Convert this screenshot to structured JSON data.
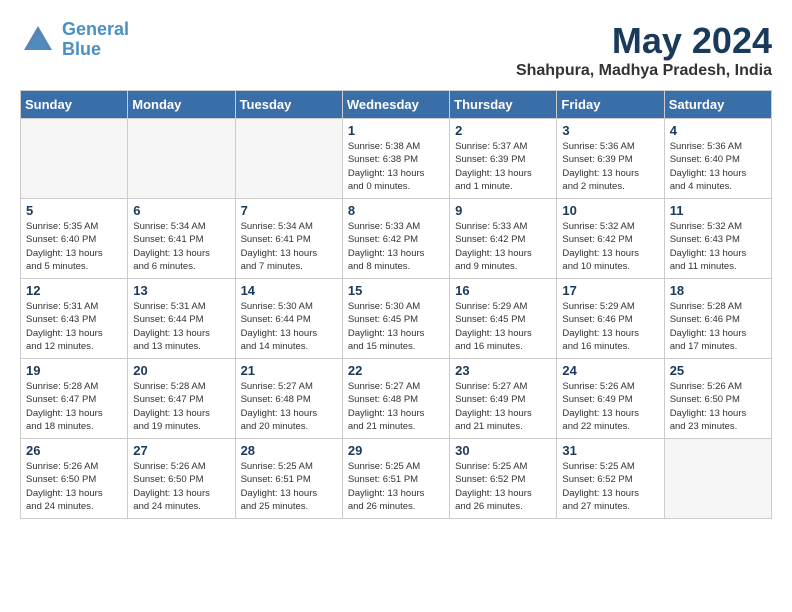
{
  "header": {
    "logo_line1": "General",
    "logo_line2": "Blue",
    "month": "May 2024",
    "location": "Shahpura, Madhya Pradesh, India"
  },
  "weekdays": [
    "Sunday",
    "Monday",
    "Tuesday",
    "Wednesday",
    "Thursday",
    "Friday",
    "Saturday"
  ],
  "weeks": [
    [
      {
        "day": "",
        "info": "",
        "empty": true
      },
      {
        "day": "",
        "info": "",
        "empty": true
      },
      {
        "day": "",
        "info": "",
        "empty": true
      },
      {
        "day": "1",
        "info": "Sunrise: 5:38 AM\nSunset: 6:38 PM\nDaylight: 13 hours\nand 0 minutes."
      },
      {
        "day": "2",
        "info": "Sunrise: 5:37 AM\nSunset: 6:39 PM\nDaylight: 13 hours\nand 1 minute."
      },
      {
        "day": "3",
        "info": "Sunrise: 5:36 AM\nSunset: 6:39 PM\nDaylight: 13 hours\nand 2 minutes."
      },
      {
        "day": "4",
        "info": "Sunrise: 5:36 AM\nSunset: 6:40 PM\nDaylight: 13 hours\nand 4 minutes."
      }
    ],
    [
      {
        "day": "5",
        "info": "Sunrise: 5:35 AM\nSunset: 6:40 PM\nDaylight: 13 hours\nand 5 minutes."
      },
      {
        "day": "6",
        "info": "Sunrise: 5:34 AM\nSunset: 6:41 PM\nDaylight: 13 hours\nand 6 minutes."
      },
      {
        "day": "7",
        "info": "Sunrise: 5:34 AM\nSunset: 6:41 PM\nDaylight: 13 hours\nand 7 minutes."
      },
      {
        "day": "8",
        "info": "Sunrise: 5:33 AM\nSunset: 6:42 PM\nDaylight: 13 hours\nand 8 minutes."
      },
      {
        "day": "9",
        "info": "Sunrise: 5:33 AM\nSunset: 6:42 PM\nDaylight: 13 hours\nand 9 minutes."
      },
      {
        "day": "10",
        "info": "Sunrise: 5:32 AM\nSunset: 6:42 PM\nDaylight: 13 hours\nand 10 minutes."
      },
      {
        "day": "11",
        "info": "Sunrise: 5:32 AM\nSunset: 6:43 PM\nDaylight: 13 hours\nand 11 minutes."
      }
    ],
    [
      {
        "day": "12",
        "info": "Sunrise: 5:31 AM\nSunset: 6:43 PM\nDaylight: 13 hours\nand 12 minutes."
      },
      {
        "day": "13",
        "info": "Sunrise: 5:31 AM\nSunset: 6:44 PM\nDaylight: 13 hours\nand 13 minutes."
      },
      {
        "day": "14",
        "info": "Sunrise: 5:30 AM\nSunset: 6:44 PM\nDaylight: 13 hours\nand 14 minutes."
      },
      {
        "day": "15",
        "info": "Sunrise: 5:30 AM\nSunset: 6:45 PM\nDaylight: 13 hours\nand 15 minutes."
      },
      {
        "day": "16",
        "info": "Sunrise: 5:29 AM\nSunset: 6:45 PM\nDaylight: 13 hours\nand 16 minutes."
      },
      {
        "day": "17",
        "info": "Sunrise: 5:29 AM\nSunset: 6:46 PM\nDaylight: 13 hours\nand 16 minutes."
      },
      {
        "day": "18",
        "info": "Sunrise: 5:28 AM\nSunset: 6:46 PM\nDaylight: 13 hours\nand 17 minutes."
      }
    ],
    [
      {
        "day": "19",
        "info": "Sunrise: 5:28 AM\nSunset: 6:47 PM\nDaylight: 13 hours\nand 18 minutes."
      },
      {
        "day": "20",
        "info": "Sunrise: 5:28 AM\nSunset: 6:47 PM\nDaylight: 13 hours\nand 19 minutes."
      },
      {
        "day": "21",
        "info": "Sunrise: 5:27 AM\nSunset: 6:48 PM\nDaylight: 13 hours\nand 20 minutes."
      },
      {
        "day": "22",
        "info": "Sunrise: 5:27 AM\nSunset: 6:48 PM\nDaylight: 13 hours\nand 21 minutes."
      },
      {
        "day": "23",
        "info": "Sunrise: 5:27 AM\nSunset: 6:49 PM\nDaylight: 13 hours\nand 21 minutes."
      },
      {
        "day": "24",
        "info": "Sunrise: 5:26 AM\nSunset: 6:49 PM\nDaylight: 13 hours\nand 22 minutes."
      },
      {
        "day": "25",
        "info": "Sunrise: 5:26 AM\nSunset: 6:50 PM\nDaylight: 13 hours\nand 23 minutes."
      }
    ],
    [
      {
        "day": "26",
        "info": "Sunrise: 5:26 AM\nSunset: 6:50 PM\nDaylight: 13 hours\nand 24 minutes."
      },
      {
        "day": "27",
        "info": "Sunrise: 5:26 AM\nSunset: 6:50 PM\nDaylight: 13 hours\nand 24 minutes."
      },
      {
        "day": "28",
        "info": "Sunrise: 5:25 AM\nSunset: 6:51 PM\nDaylight: 13 hours\nand 25 minutes."
      },
      {
        "day": "29",
        "info": "Sunrise: 5:25 AM\nSunset: 6:51 PM\nDaylight: 13 hours\nand 26 minutes."
      },
      {
        "day": "30",
        "info": "Sunrise: 5:25 AM\nSunset: 6:52 PM\nDaylight: 13 hours\nand 26 minutes."
      },
      {
        "day": "31",
        "info": "Sunrise: 5:25 AM\nSunset: 6:52 PM\nDaylight: 13 hours\nand 27 minutes."
      },
      {
        "day": "",
        "info": "",
        "empty": true
      }
    ]
  ]
}
